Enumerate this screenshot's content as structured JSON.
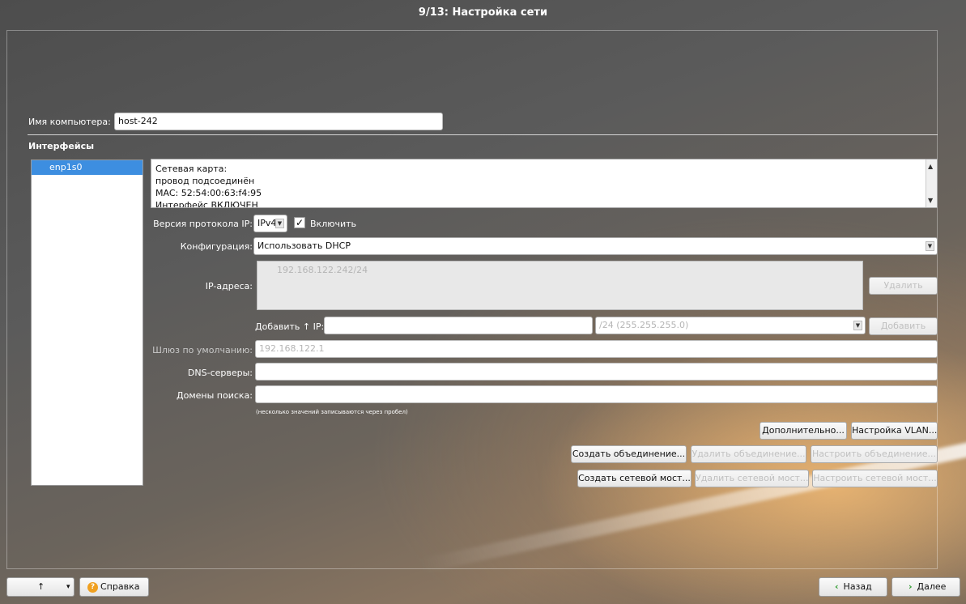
{
  "window": {
    "title": "9/13: Настройка сети"
  },
  "hostname": {
    "label": "Имя компьютера:",
    "value": "host-242"
  },
  "interfaces": {
    "section_label": "Интерфейсы",
    "list": [
      "enp1s0"
    ],
    "info_lines": [
      "Сетевая карта:",
      "провод подсоединён",
      "MAC: 52:54:00:63:f4:95",
      "Интерфейс ВКЛЮЧЕН"
    ]
  },
  "protocol": {
    "label": "Версия протокола IP:",
    "value": "IPv4",
    "enable_label": "Включить",
    "enabled": true
  },
  "config": {
    "label": "Конфигурация:",
    "value": "Использовать DHCP"
  },
  "ip": {
    "label": "IP-адреса:",
    "addresses": [
      "192.168.122.242/24"
    ],
    "delete_button": "Удалить",
    "add_label": "Добавить ↑ IP:",
    "add_value": "",
    "mask_value": "/24 (255.255.255.0)",
    "add_button": "Добавить"
  },
  "gateway": {
    "label": "Шлюз по умолчанию:",
    "value": "192.168.122.1"
  },
  "dns": {
    "label": "DNS-серверы:",
    "value": ""
  },
  "search": {
    "label": "Домены поиска:",
    "value": ""
  },
  "hint": "(несколько значений записываются через пробел)",
  "buttons": {
    "advanced": "Дополнительно...",
    "vlan": "Настройка VLAN...",
    "create_bond": "Создать объединение...",
    "delete_bond": "Удалить объединение...",
    "configure_bond": "Настроить объединение...",
    "create_bridge": "Создать сетевой мост...",
    "delete_bridge": "Удалить сетевой мост...",
    "configure_bridge": "Настроить сетевой мост..."
  },
  "footer": {
    "up_arrow": "↑",
    "dropdown_arrow": "▾",
    "help": "Справка",
    "back": "Назад",
    "next": "Далее"
  }
}
